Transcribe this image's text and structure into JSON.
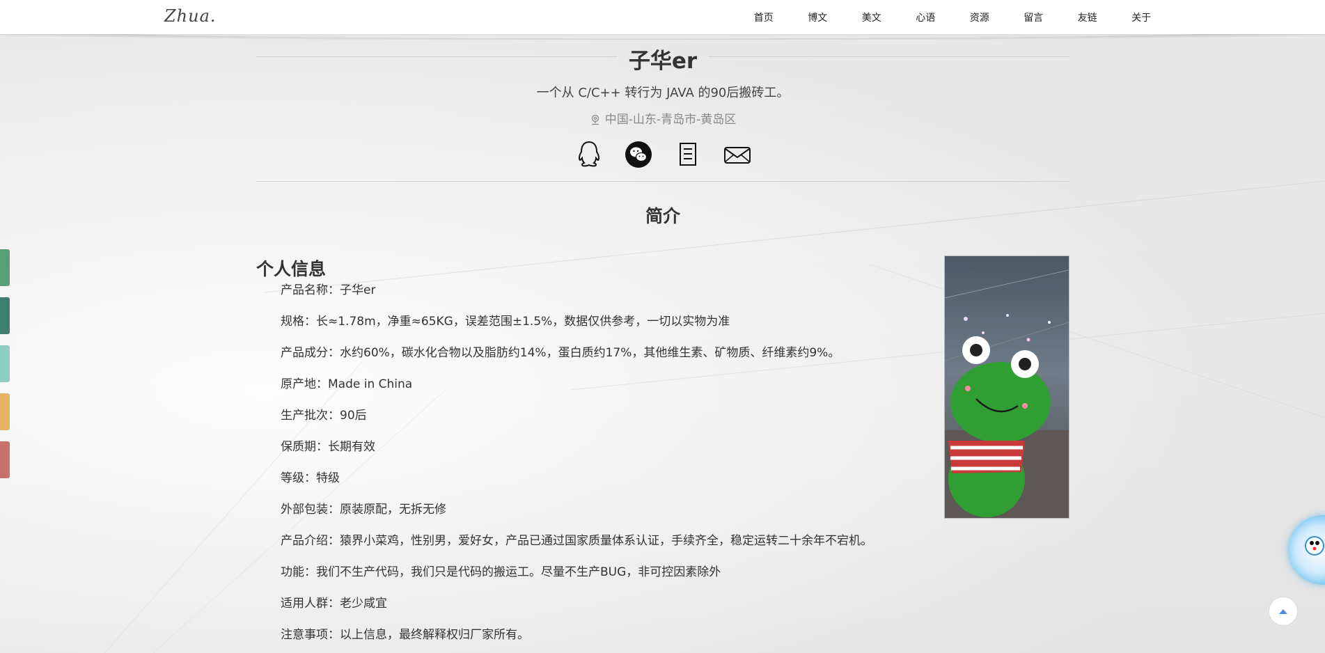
{
  "header": {
    "logo_text": "Zhua.",
    "nav_items": [
      "首页",
      "博文",
      "美文",
      "心语",
      "资源",
      "留言",
      "友链",
      "关于"
    ]
  },
  "profile": {
    "name": "子华er",
    "motto": "一个从 C/C++ 转行为 JAVA 的90后搬砖工。",
    "location": "中国-山东-青岛市-黄岛区",
    "social_icons": [
      "qq-icon",
      "wechat-icon",
      "document-icon",
      "mail-icon"
    ]
  },
  "intro": {
    "section_title": "简介",
    "info_heading": "个人信息",
    "items": [
      "产品名称：子华er",
      "规格：长≈1.78m，净重≈65KG，误差范围±1.5%，数据仅供参考，一切以实物为准",
      "产品成分：水约60%，碳水化合物以及脂肪约14%，蛋白质约17%，其他维生素、矿物质、纤维素约9%。",
      "原产地：Made in China",
      "生产批次：90后",
      "保质期：长期有效",
      "等级：特级",
      "外部包装：原装原配，无拆无修",
      "产品介绍：猿界小菜鸡，性别男，爱好女，产品已通过国家质量体系认证，手续齐全，稳定运转二十余年不宕机。",
      "功能：我们不生产代码，我们只是代码的搬运工。尽量不生产BUG，非可控因素除外",
      "适用人群：老少咸宜",
      "注意事项：以上信息，最终解释权归厂家所有。"
    ]
  },
  "left_tabs": {
    "colors": [
      "#5a9e77",
      "#3f7f6f",
      "#8ecdc2",
      "#e6b266",
      "#c8716a"
    ]
  },
  "accent_colors": {
    "mascot": "#6cc0f0",
    "back_top_arrow": "#4a90e2"
  }
}
